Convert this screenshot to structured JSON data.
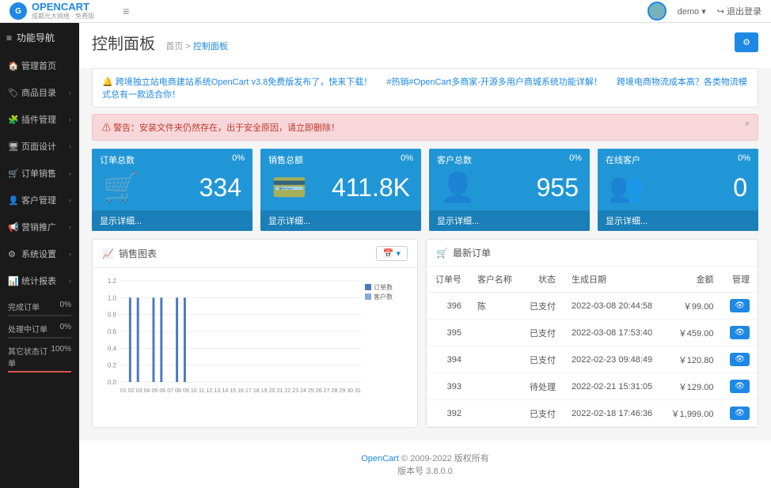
{
  "header": {
    "logo_text": "OPENCART",
    "logo_sub": "成都光大网络 · 免费版",
    "user": "demo",
    "logout": "退出登录"
  },
  "sidebar": {
    "header": "功能导航",
    "items": [
      {
        "icon": "🏠",
        "label": "管理首页",
        "chev": false
      },
      {
        "icon": "🏷",
        "label": "商品目录",
        "chev": true
      },
      {
        "icon": "🧩",
        "label": "插件管理",
        "chev": true
      },
      {
        "icon": "🖥",
        "label": "页面设计",
        "chev": true
      },
      {
        "icon": "🛒",
        "label": "订单销售",
        "chev": true
      },
      {
        "icon": "👤",
        "label": "客户管理",
        "chev": true
      },
      {
        "icon": "📢",
        "label": "营销推广",
        "chev": true
      },
      {
        "icon": "⚙",
        "label": "系统设置",
        "chev": true
      },
      {
        "icon": "📊",
        "label": "统计报表",
        "chev": true
      }
    ],
    "progress": [
      {
        "label": "完成订单",
        "pct": "0%",
        "w": 0,
        "cls": ""
      },
      {
        "label": "处理中订单",
        "pct": "0%",
        "w": 0,
        "cls": ""
      },
      {
        "label": "其它状态订单",
        "pct": "100%",
        "w": 100,
        "cls": "red"
      }
    ]
  },
  "page": {
    "title": "控制面板",
    "bc_home": "首页",
    "bc_current": "控制面板"
  },
  "notices": [
    "跨境独立站电商建站系统OpenCart v3.8免费版发布了，快来下载！",
    "#热销#OpenCart多商家-开源多用户商城系统功能详解！",
    "跨境电商物流成本高？各类物流模式总有一款适合你！"
  ],
  "alert": "警告：安装文件夹仍然存在，出于安全原因，请立即删除！",
  "tiles": [
    {
      "title": "订单总数",
      "pct": "0%",
      "icon": "🛒",
      "value": "334",
      "more": "显示详细..."
    },
    {
      "title": "销售总额",
      "pct": "0%",
      "icon": "💳",
      "value": "411.8K",
      "more": "显示详细..."
    },
    {
      "title": "客户总数",
      "pct": "0%",
      "icon": "👤",
      "value": "955",
      "more": "显示详细..."
    },
    {
      "title": "在线客户",
      "pct": "0%",
      "icon": "👥",
      "value": "0",
      "more": "显示详细..."
    }
  ],
  "chart": {
    "title": "销售图表",
    "legend1": "订单数",
    "legend2": "客户数"
  },
  "chart_data": {
    "type": "bar",
    "title": "销售图表",
    "xlabel": "",
    "ylabel": "",
    "ylim": [
      0,
      1.2
    ],
    "yticks": [
      0,
      0.2,
      0.4,
      0.6,
      0.8,
      1.0,
      1.2
    ],
    "categories": [
      "01",
      "02",
      "03",
      "04",
      "05",
      "06",
      "07",
      "08",
      "09",
      "10",
      "11",
      "12",
      "13",
      "14",
      "15",
      "16",
      "17",
      "18",
      "19",
      "20",
      "21",
      "22",
      "23",
      "24",
      "25",
      "26",
      "27",
      "28",
      "29",
      "30",
      "31"
    ],
    "series": [
      {
        "name": "订单数",
        "color": "#4a79c4",
        "values": [
          0,
          1,
          1,
          0,
          1,
          1,
          0,
          1,
          1,
          0,
          0,
          0,
          0,
          0,
          0,
          0,
          0,
          0,
          0,
          0,
          0,
          0,
          0,
          0,
          0,
          0,
          0,
          0,
          0,
          0,
          0
        ]
      },
      {
        "name": "客户数",
        "color": "#8aa9d8",
        "values": [
          0,
          0,
          0,
          0,
          0,
          0,
          0,
          0,
          0,
          0,
          0,
          0,
          0,
          0,
          0,
          0,
          0,
          0,
          0,
          0,
          0,
          0,
          0,
          0,
          0,
          0,
          0,
          0,
          0,
          0,
          0
        ]
      }
    ]
  },
  "orders": {
    "title": "最新订单",
    "cols": {
      "id": "订单号",
      "customer": "客户名称",
      "status": "状态",
      "date": "生成日期",
      "amount": "金额",
      "mgmt": "管理"
    },
    "rows": [
      {
        "id": "396",
        "customer": "陈",
        "status": "已支付",
        "date": "2022-03-08 20:44:58",
        "amount": "￥99.00"
      },
      {
        "id": "395",
        "customer": "",
        "status": "已支付",
        "date": "2022-03-08 17:53:40",
        "amount": "￥459.00"
      },
      {
        "id": "394",
        "customer": "",
        "status": "已支付",
        "date": "2022-02-23 09:48:49",
        "amount": "￥120.80"
      },
      {
        "id": "393",
        "customer": "",
        "status": "待处理",
        "date": "2022-02-21 15:31:05",
        "amount": "￥129.00"
      },
      {
        "id": "392",
        "customer": "",
        "status": "已支付",
        "date": "2022-02-18 17:46:36",
        "amount": "￥1,999.00"
      }
    ]
  },
  "footer": {
    "link": "OpenCart",
    "copy": " © 2009-2022 版权所有",
    "version": "版本号 3.8.0.0"
  }
}
